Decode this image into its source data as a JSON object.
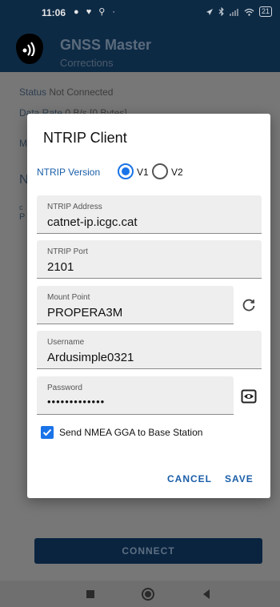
{
  "status_bar": {
    "time": "11:06",
    "left_icons": "● ♥ ⚲ ·",
    "battery": "21"
  },
  "app": {
    "title": "GNSS Master",
    "subtitle": "Corrections"
  },
  "background": {
    "status_label": "Status",
    "status_value": "Not Connected",
    "data_rate_label": "Data Rate",
    "data_rate_value": "0 B/s [0 Bytes]",
    "partial_letter_m": "M",
    "partial_letter_n": "N",
    "partial_letter_c": "c",
    "partial_letter_p": "P",
    "connect_button": "CONNECT"
  },
  "dialog": {
    "title": "NTRIP Client",
    "version_label": "NTRIP Version",
    "versions": [
      {
        "label": "V1",
        "selected": true
      },
      {
        "label": "V2",
        "selected": false
      }
    ],
    "fields": {
      "address": {
        "label": "NTRIP Address",
        "value": "catnet-ip.icgc.cat"
      },
      "port": {
        "label": "NTRIP Port",
        "value": "2101"
      },
      "mount_point": {
        "label": "Mount Point",
        "value": "PROPERA3M"
      },
      "username": {
        "label": "Username",
        "value": "Ardusimple0321"
      },
      "password": {
        "label": "Password",
        "value": "•••••••••••••"
      }
    },
    "send_gga": {
      "label": "Send NMEA GGA to Base Station",
      "checked": true
    },
    "cancel_label": "CANCEL",
    "save_label": "SAVE"
  },
  "colors": {
    "accent": "#1a73e8",
    "appbar": "#0d2a45",
    "button_text": "#1a5ea8"
  }
}
